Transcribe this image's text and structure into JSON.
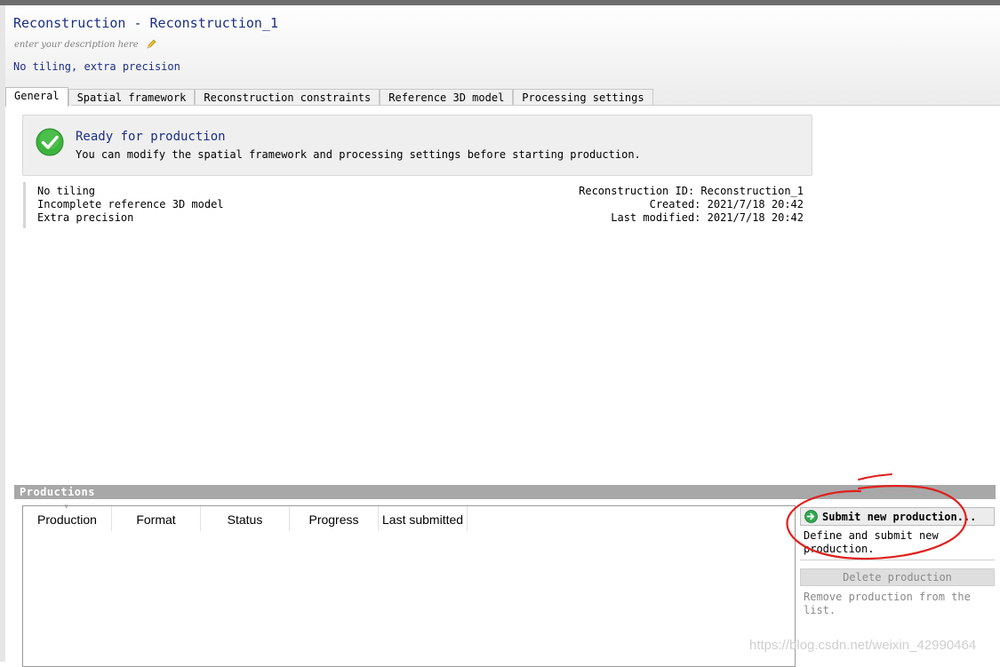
{
  "header": {
    "title": "Reconstruction - Reconstruction_1",
    "description_placeholder": "enter your description here",
    "subtitle": "No tiling, extra precision"
  },
  "tabs": [
    {
      "label": "General",
      "active": true
    },
    {
      "label": "Spatial framework",
      "active": false
    },
    {
      "label": "Reconstruction constraints",
      "active": false
    },
    {
      "label": "Reference 3D model",
      "active": false
    },
    {
      "label": "Processing settings",
      "active": false
    }
  ],
  "status": {
    "icon": "check-circle-icon",
    "color": "#34a834",
    "title": "Ready for production",
    "text": "You can modify the spatial framework and processing settings before starting production."
  },
  "info": {
    "left": [
      "No tiling",
      "Incomplete reference 3D model",
      "Extra precision"
    ],
    "right": [
      "Reconstruction ID: Reconstruction_1",
      "Created: 2021/7/18 20:42",
      "Last modified: 2021/7/18 20:42"
    ]
  },
  "productions": {
    "header": "Productions",
    "columns": [
      "Production",
      "Format",
      "Status",
      "Progress",
      "Last submitted"
    ],
    "rows": []
  },
  "actions": {
    "submit_label": "Submit new production...",
    "submit_help": "Define and submit new production.",
    "delete_label": "Delete production",
    "delete_help": "Remove production from the list."
  },
  "annotation_color": "#e0201c",
  "watermark": "https://blog.csdn.net/weixin_42990464"
}
